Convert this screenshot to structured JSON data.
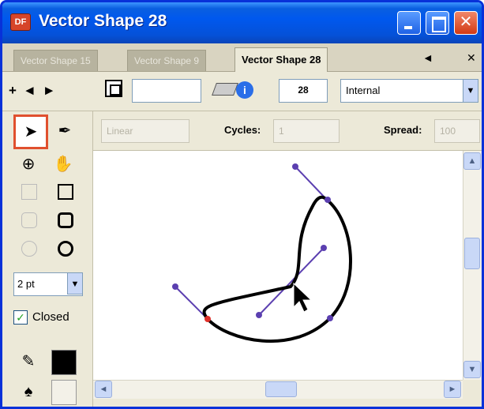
{
  "window": {
    "title": "Vector Shape 28",
    "app_icon_text": "DF"
  },
  "tabs": [
    {
      "label": "Vector Shape 15",
      "active": false
    },
    {
      "label": "Vector Shape 9",
      "active": false
    },
    {
      "label": "Vector Shape 28",
      "active": true
    }
  ],
  "toolbar": {
    "stroke_value": "",
    "number_value": "28",
    "position_value": "Internal"
  },
  "options": {
    "mode_value": "Linear",
    "cycles_label": "Cycles:",
    "cycles_value": "1",
    "spread_label": "Spread:",
    "spread_value": "100"
  },
  "tools": {
    "stroke_width_value": "2 pt",
    "closed_label": "Closed",
    "closed_checked": true
  },
  "colors": {
    "stroke_color": "#000000",
    "fill_color": "#ece9d8",
    "accent": "#e0502e",
    "handle_color": "#5b3fb0"
  },
  "icons": [
    "arrow-select-icon",
    "pen-icon",
    "move-icon",
    "hand-icon",
    "eyedropper-icon",
    "paint-bucket-icon",
    "eraser-icon",
    "info-icon"
  ]
}
